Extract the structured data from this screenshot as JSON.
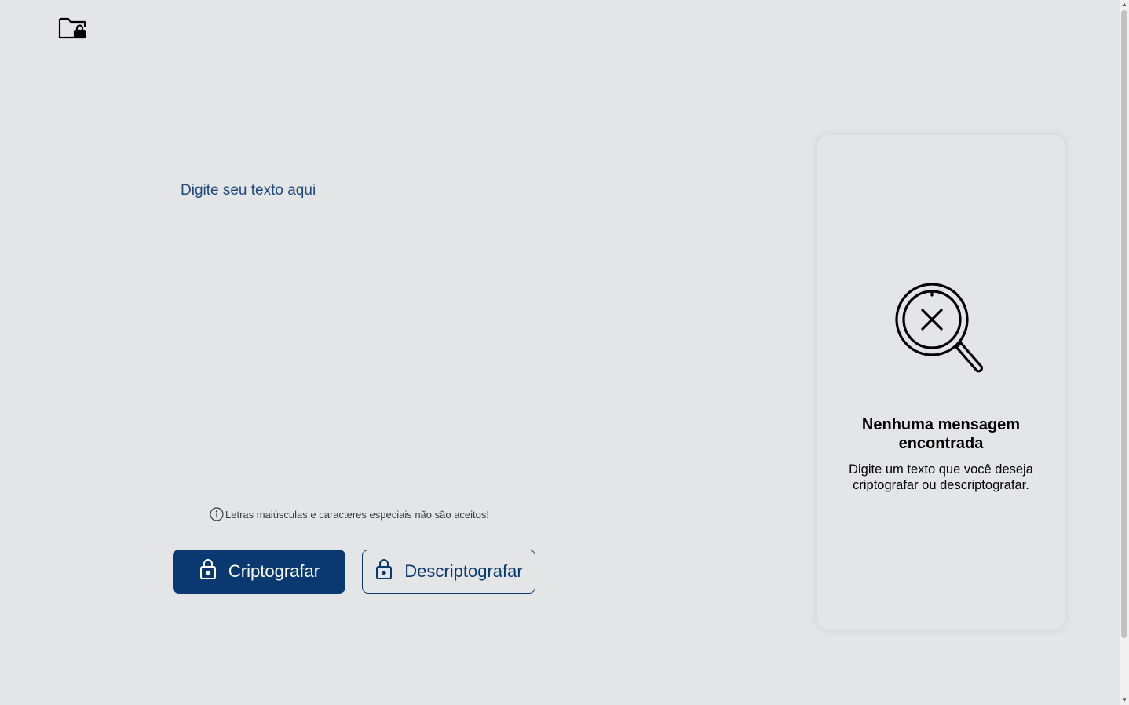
{
  "header": {
    "logo_icon": "folder-lock-icon"
  },
  "editor": {
    "placeholder": "Digite seu texto aqui"
  },
  "hint": {
    "icon": "info-icon",
    "text": "Letras maiúsculas e caracteres especiais não são aceitos!"
  },
  "actions": {
    "encrypt_label": "Criptografar",
    "decrypt_label": "Descriptografar",
    "button_icon": "lock-icon"
  },
  "output": {
    "illustration_icon": "search-not-found-icon",
    "title": "Nenhuma mensagem encontrada",
    "description": "Digite um texto que você deseja criptografar ou descriptografar."
  },
  "colors": {
    "background": "#e4e5e6",
    "accent": "#0a3871",
    "text": "#000000"
  }
}
